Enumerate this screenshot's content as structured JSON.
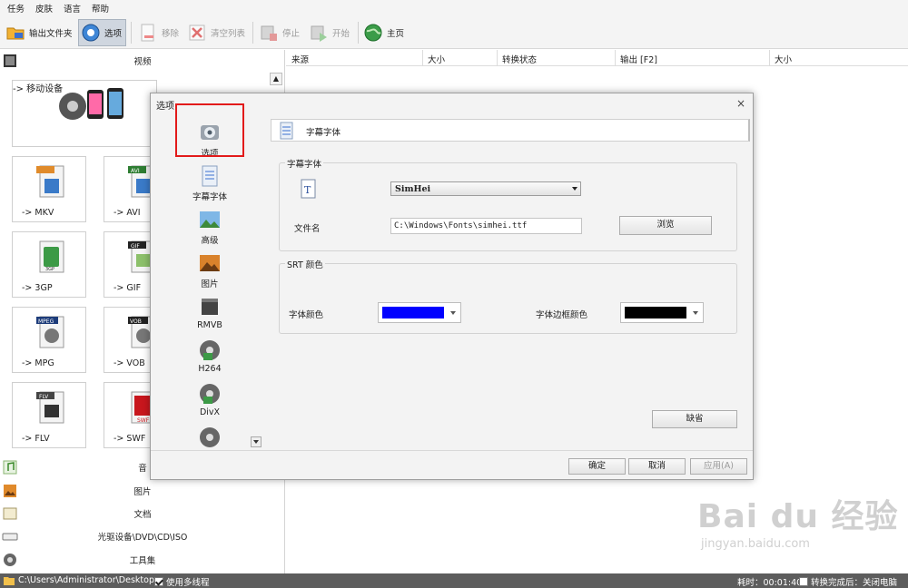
{
  "menu": [
    "任务",
    "皮肤",
    "语言",
    "帮助"
  ],
  "toolbar": {
    "output_folder": "输出文件夹",
    "options": "选项",
    "remove": "移除",
    "clear_list": "清空列表",
    "stop": "停止",
    "start": "开始",
    "home": "主页"
  },
  "left": {
    "video_category": "视频",
    "mobile": "-> 移动设备",
    "tiles": [
      "-> MKV",
      "-> AVI",
      "-> 3GP",
      "-> GIF",
      "-> MPG",
      "-> VOB",
      "-> FLV",
      "-> SWF"
    ],
    "tile_badges": [
      "AVI",
      "GIF",
      "MPEG",
      "VOB",
      "FLV",
      "SWF",
      "3GP"
    ],
    "audio_category": "音",
    "image_category": "图片",
    "document_category": "文档",
    "disc_category": "光驱设备\\DVD\\CD\\ISO",
    "tools_category": "工具集"
  },
  "list_headers": [
    "来源",
    "大小",
    "转换状态",
    "输出 [F2]",
    "大小"
  ],
  "status": {
    "path": "C:\\Users\\Administrator\\Desktop",
    "multithread": "使用多线程",
    "elapsed": "耗时：00:01:40",
    "after_done": "转换完成后：关闭电脑"
  },
  "dialog": {
    "title": "选项",
    "close": "×",
    "nav": [
      "选项",
      "字幕字体",
      "高级",
      "图片",
      "RMVB",
      "H264",
      "DivX"
    ],
    "section_title": "字幕字体",
    "group1_title": "字幕字体",
    "font_value": "SimHei",
    "file_label": "文件名",
    "file_value": "C:\\Windows\\Fonts\\simhei.ttf",
    "browse": "浏览",
    "group2_title": "SRT 颜色",
    "font_color_label": "字体颜色",
    "border_color_label": "字体边框颜色",
    "font_color": "#0000ff",
    "border_color": "#000000",
    "default_btn": "缺省",
    "ok": "确定",
    "cancel": "取消",
    "apply": "应用(A)"
  },
  "watermark": {
    "logo": "Bai du 经验",
    "url": "jingyan.baidu.com"
  }
}
